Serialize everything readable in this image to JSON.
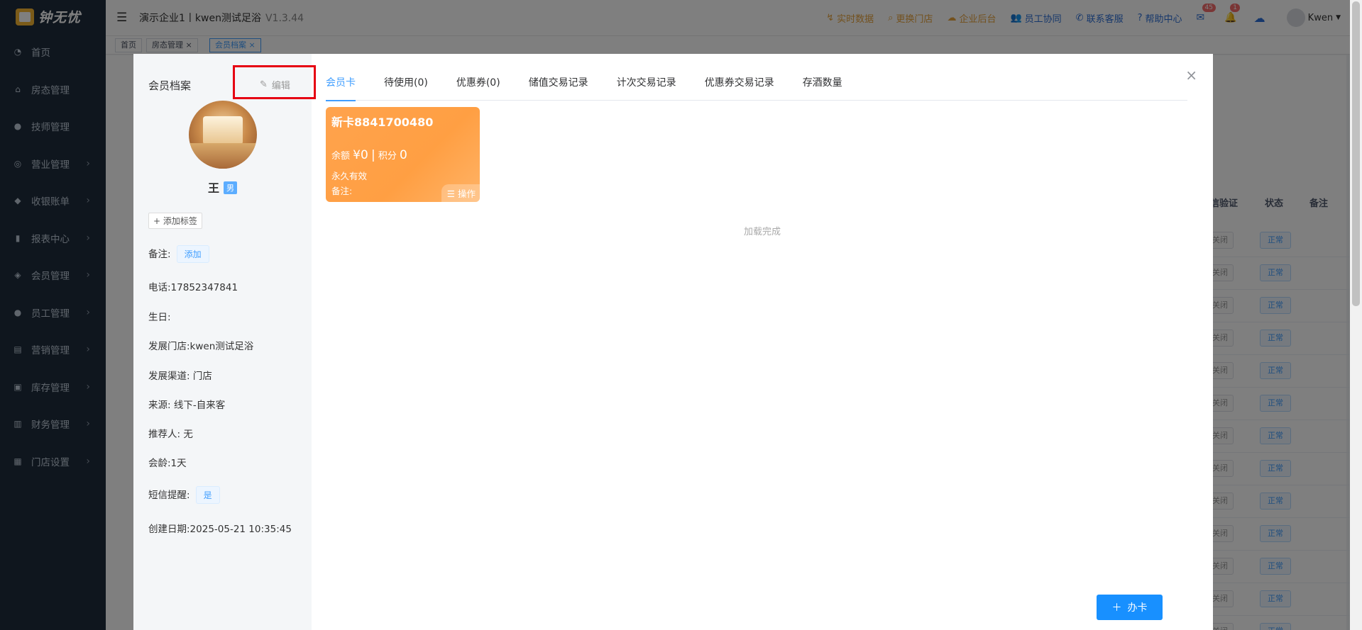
{
  "app": {
    "logo_text": "钟无忧",
    "title": "演示企业1丨kwen测试足浴",
    "version": "V1.3.44"
  },
  "sidebar": {
    "items": [
      {
        "label": "首页",
        "icon": "speedometer-icon"
      },
      {
        "label": "房态管理",
        "icon": "home-icon"
      },
      {
        "label": "技师管理",
        "icon": "person-icon"
      },
      {
        "label": "营业管理",
        "icon": "target-icon"
      },
      {
        "label": "收银账单",
        "icon": "bag-icon"
      },
      {
        "label": "报表中心",
        "icon": "bar-chart-icon"
      },
      {
        "label": "会员管理",
        "icon": "diamond-icon"
      },
      {
        "label": "员工管理",
        "icon": "person-icon"
      },
      {
        "label": "营销管理",
        "icon": "briefcase-icon"
      },
      {
        "label": "库存管理",
        "icon": "box-icon"
      },
      {
        "label": "财务管理",
        "icon": "wallet-icon"
      },
      {
        "label": "门店设置",
        "icon": "grid-icon"
      }
    ]
  },
  "topbar": {
    "links": [
      {
        "label": "实时数据",
        "color": "orange"
      },
      {
        "label": "更换门店",
        "color": "orange"
      },
      {
        "label": "企业后台",
        "color": "orange"
      },
      {
        "label": "员工协同",
        "color": "blue"
      },
      {
        "label": "联系客服",
        "color": "blue"
      },
      {
        "label": "帮助中心",
        "color": "blue"
      }
    ],
    "mail_badge": "45",
    "bell_badge": "1",
    "user_name": "Kwen"
  },
  "tags": [
    {
      "label": "首页"
    },
    {
      "label": "房态管理"
    },
    {
      "label": "会员档案"
    }
  ],
  "background_table": {
    "headers": [
      "信验证",
      "状态",
      "备注"
    ],
    "row_btn_left": "关闭",
    "row_btn_right": "正常"
  },
  "modal": {
    "left_title": "会员档案",
    "edit_label": "编辑",
    "member_name": "王",
    "gender": "男",
    "add_tag_label": "+ 添加标签",
    "remark_label": "备注:",
    "remark_add": "添加",
    "phone": "电话:17852347841",
    "birthday": "生日:",
    "dev_store": "发展门店:kwen测试足浴",
    "dev_channel": "发展渠道: 门店",
    "source": "来源: 线下-自来客",
    "referrer": "推荐人: 无",
    "member_age": "会龄:1天",
    "sms_label": "短信提醒:",
    "sms_value": "是",
    "created": "创建日期:2025-05-21 10:35:45",
    "tabs": [
      {
        "label": "会员卡"
      },
      {
        "label": "待使用(0)"
      },
      {
        "label": "优惠券(0)"
      },
      {
        "label": "储值交易记录"
      },
      {
        "label": "计次交易记录"
      },
      {
        "label": "优惠券交易记录"
      },
      {
        "label": "存酒数量"
      }
    ],
    "card": {
      "title": "新卡8841700480",
      "balance_label": "余额",
      "balance_value": "¥0",
      "separator": "|",
      "points_label": "积分",
      "points_value": "0",
      "validity": "永久有效",
      "note": "备注:",
      "op_label": "操作"
    },
    "loaded_text": "加载完成",
    "open_card_label": "办卡"
  }
}
